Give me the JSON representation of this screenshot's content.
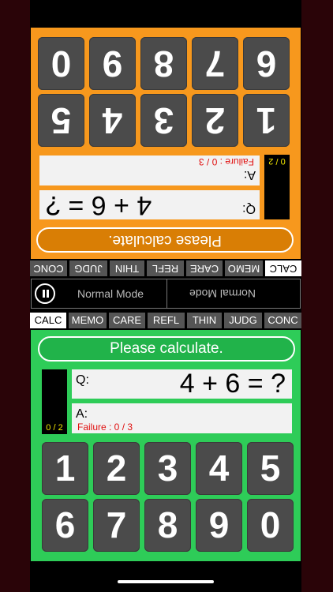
{
  "players": {
    "top": {
      "prompt": "Please calculate.",
      "score": "0 / 2",
      "question_label": "Q:",
      "question": "4 + 6 = ?",
      "answer_label": "A:",
      "answer": "",
      "failure": "Failure : 0 / 3",
      "keys": [
        "1",
        "2",
        "3",
        "4",
        "5",
        "6",
        "7",
        "8",
        "9",
        "0"
      ]
    },
    "bottom": {
      "prompt": "Please calculate.",
      "score": "0 / 2",
      "question_label": "Q:",
      "question": "4 + 6 = ?",
      "answer_label": "A:",
      "answer": "",
      "failure": "Failure : 0 / 3",
      "keys": [
        "1",
        "2",
        "3",
        "4",
        "5",
        "6",
        "7",
        "8",
        "9",
        "0"
      ]
    }
  },
  "tabs": [
    "CALC",
    "MEMO",
    "CARE",
    "REFL",
    "THIN",
    "JUDG",
    "CONC"
  ],
  "active_tab": "CALC",
  "mode": {
    "left": "Normal Mode",
    "right": "Normal Mode"
  },
  "colors": {
    "top_panel": "#f7981d",
    "bottom_panel": "#2ecc58",
    "key": "#4b4b4b",
    "failure": "#e01010",
    "score": "#f2e600"
  }
}
